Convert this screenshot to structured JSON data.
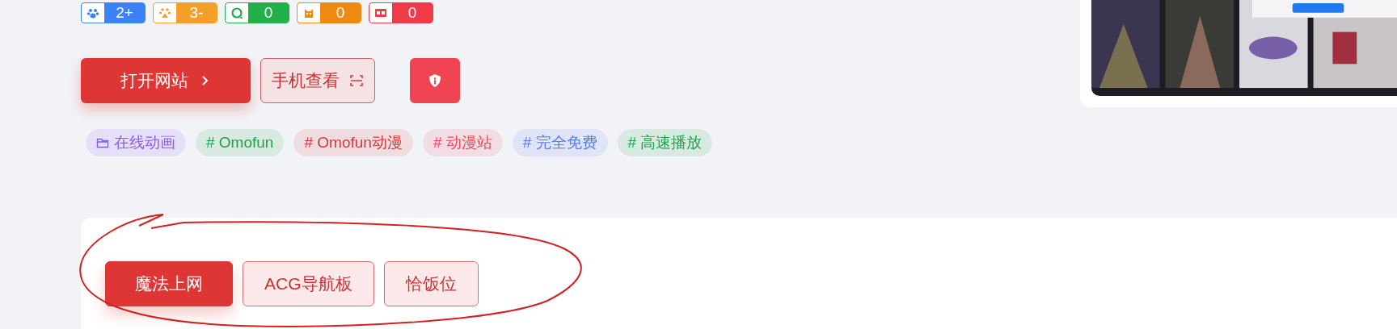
{
  "rank_badges": [
    {
      "kind": "paw",
      "value": "2+",
      "color": "#3b82f6"
    },
    {
      "kind": "paw-house",
      "value": "3-",
      "color": "#f59e2a"
    },
    {
      "kind": "ring",
      "value": "0",
      "color": "#22b04b"
    },
    {
      "kind": "owl",
      "value": "0",
      "color": "#ee8a12"
    },
    {
      "kind": "headline",
      "value": "0",
      "color": "#f03a47"
    }
  ],
  "actions": [
    {
      "kind": "primary",
      "label": "打开网站"
    },
    {
      "kind": "outline",
      "label": "手机查看"
    },
    {
      "kind": "icon"
    }
  ],
  "tags": [
    {
      "kind": "category",
      "label": "在线动画",
      "color": "#8b5cf6"
    },
    {
      "kind": "tag",
      "label": "# Omofun",
      "color": "#22a447"
    },
    {
      "kind": "tag",
      "label": "# Omofun动漫",
      "color": "#d83a3a"
    },
    {
      "kind": "tag",
      "label": "# 动漫站",
      "color": "#ee4b5a"
    },
    {
      "kind": "tag",
      "label": "# 完全免费",
      "color": "#5b7cf0"
    },
    {
      "kind": "tag",
      "label": "# 高速播放",
      "color": "#22a447"
    }
  ],
  "section_tabs": [
    {
      "label": "魔法上网",
      "selected": true
    },
    {
      "label": "ACG导航板",
      "selected": false
    },
    {
      "label": "恰饭位",
      "selected": false
    }
  ]
}
